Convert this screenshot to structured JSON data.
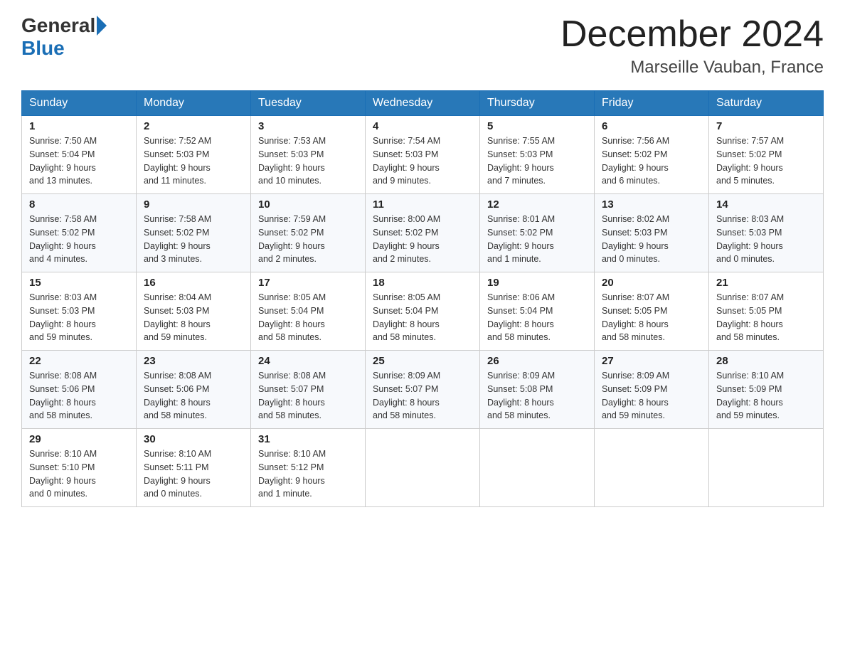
{
  "header": {
    "logo_general": "General",
    "logo_blue": "Blue",
    "month_title": "December 2024",
    "location": "Marseille Vauban, France"
  },
  "days_of_week": [
    "Sunday",
    "Monday",
    "Tuesday",
    "Wednesday",
    "Thursday",
    "Friday",
    "Saturday"
  ],
  "weeks": [
    [
      {
        "day": "1",
        "sunrise": "7:50 AM",
        "sunset": "5:04 PM",
        "daylight": "9 hours and 13 minutes."
      },
      {
        "day": "2",
        "sunrise": "7:52 AM",
        "sunset": "5:03 PM",
        "daylight": "9 hours and 11 minutes."
      },
      {
        "day": "3",
        "sunrise": "7:53 AM",
        "sunset": "5:03 PM",
        "daylight": "9 hours and 10 minutes."
      },
      {
        "day": "4",
        "sunrise": "7:54 AM",
        "sunset": "5:03 PM",
        "daylight": "9 hours and 9 minutes."
      },
      {
        "day": "5",
        "sunrise": "7:55 AM",
        "sunset": "5:03 PM",
        "daylight": "9 hours and 7 minutes."
      },
      {
        "day": "6",
        "sunrise": "7:56 AM",
        "sunset": "5:02 PM",
        "daylight": "9 hours and 6 minutes."
      },
      {
        "day": "7",
        "sunrise": "7:57 AM",
        "sunset": "5:02 PM",
        "daylight": "9 hours and 5 minutes."
      }
    ],
    [
      {
        "day": "8",
        "sunrise": "7:58 AM",
        "sunset": "5:02 PM",
        "daylight": "9 hours and 4 minutes."
      },
      {
        "day": "9",
        "sunrise": "7:58 AM",
        "sunset": "5:02 PM",
        "daylight": "9 hours and 3 minutes."
      },
      {
        "day": "10",
        "sunrise": "7:59 AM",
        "sunset": "5:02 PM",
        "daylight": "9 hours and 2 minutes."
      },
      {
        "day": "11",
        "sunrise": "8:00 AM",
        "sunset": "5:02 PM",
        "daylight": "9 hours and 2 minutes."
      },
      {
        "day": "12",
        "sunrise": "8:01 AM",
        "sunset": "5:02 PM",
        "daylight": "9 hours and 1 minute."
      },
      {
        "day": "13",
        "sunrise": "8:02 AM",
        "sunset": "5:03 PM",
        "daylight": "9 hours and 0 minutes."
      },
      {
        "day": "14",
        "sunrise": "8:03 AM",
        "sunset": "5:03 PM",
        "daylight": "9 hours and 0 minutes."
      }
    ],
    [
      {
        "day": "15",
        "sunrise": "8:03 AM",
        "sunset": "5:03 PM",
        "daylight": "8 hours and 59 minutes."
      },
      {
        "day": "16",
        "sunrise": "8:04 AM",
        "sunset": "5:03 PM",
        "daylight": "8 hours and 59 minutes."
      },
      {
        "day": "17",
        "sunrise": "8:05 AM",
        "sunset": "5:04 PM",
        "daylight": "8 hours and 58 minutes."
      },
      {
        "day": "18",
        "sunrise": "8:05 AM",
        "sunset": "5:04 PM",
        "daylight": "8 hours and 58 minutes."
      },
      {
        "day": "19",
        "sunrise": "8:06 AM",
        "sunset": "5:04 PM",
        "daylight": "8 hours and 58 minutes."
      },
      {
        "day": "20",
        "sunrise": "8:07 AM",
        "sunset": "5:05 PM",
        "daylight": "8 hours and 58 minutes."
      },
      {
        "day": "21",
        "sunrise": "8:07 AM",
        "sunset": "5:05 PM",
        "daylight": "8 hours and 58 minutes."
      }
    ],
    [
      {
        "day": "22",
        "sunrise": "8:08 AM",
        "sunset": "5:06 PM",
        "daylight": "8 hours and 58 minutes."
      },
      {
        "day": "23",
        "sunrise": "8:08 AM",
        "sunset": "5:06 PM",
        "daylight": "8 hours and 58 minutes."
      },
      {
        "day": "24",
        "sunrise": "8:08 AM",
        "sunset": "5:07 PM",
        "daylight": "8 hours and 58 minutes."
      },
      {
        "day": "25",
        "sunrise": "8:09 AM",
        "sunset": "5:07 PM",
        "daylight": "8 hours and 58 minutes."
      },
      {
        "day": "26",
        "sunrise": "8:09 AM",
        "sunset": "5:08 PM",
        "daylight": "8 hours and 58 minutes."
      },
      {
        "day": "27",
        "sunrise": "8:09 AM",
        "sunset": "5:09 PM",
        "daylight": "8 hours and 59 minutes."
      },
      {
        "day": "28",
        "sunrise": "8:10 AM",
        "sunset": "5:09 PM",
        "daylight": "8 hours and 59 minutes."
      }
    ],
    [
      {
        "day": "29",
        "sunrise": "8:10 AM",
        "sunset": "5:10 PM",
        "daylight": "9 hours and 0 minutes."
      },
      {
        "day": "30",
        "sunrise": "8:10 AM",
        "sunset": "5:11 PM",
        "daylight": "9 hours and 0 minutes."
      },
      {
        "day": "31",
        "sunrise": "8:10 AM",
        "sunset": "5:12 PM",
        "daylight": "9 hours and 1 minute."
      },
      null,
      null,
      null,
      null
    ]
  ],
  "labels": {
    "sunrise": "Sunrise:",
    "sunset": "Sunset:",
    "daylight": "Daylight:"
  }
}
